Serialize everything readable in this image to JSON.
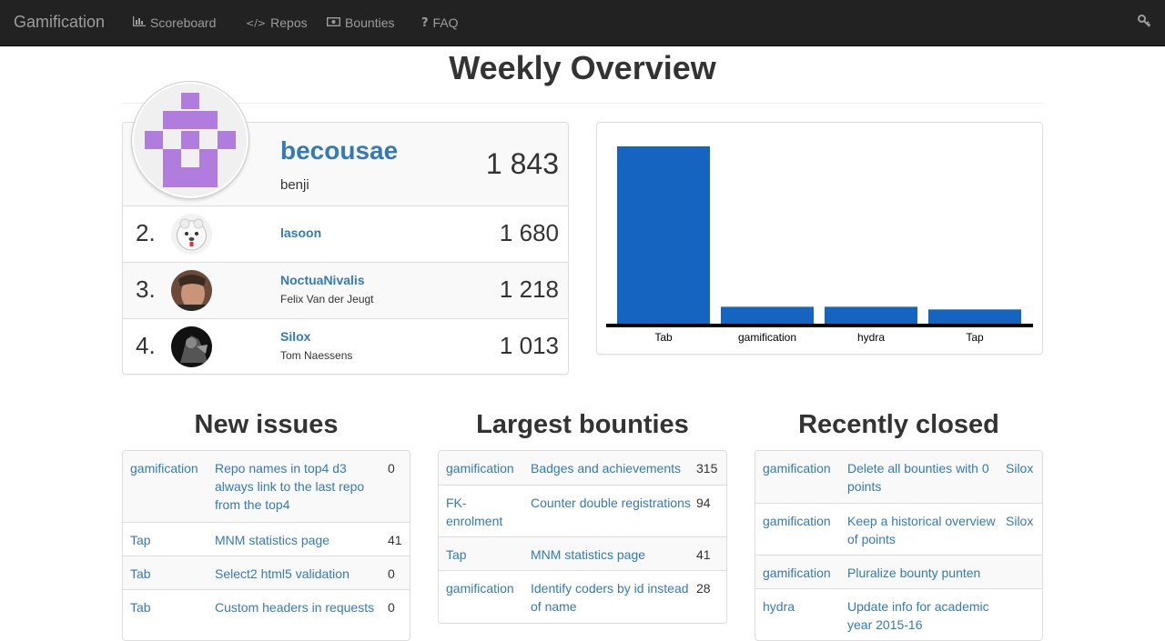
{
  "nav": {
    "brand": "Gamification",
    "items": [
      {
        "label": "Scoreboard",
        "icon": "bar-chart-icon"
      },
      {
        "label": "Repos",
        "icon": "code-icon"
      },
      {
        "label": "Bounties",
        "icon": "money-icon"
      },
      {
        "label": "FAQ",
        "icon": "question-icon"
      }
    ],
    "right_icon": "key-icon"
  },
  "page_title": "Weekly Overview",
  "leaderboard": {
    "top": {
      "name": "becousae",
      "fullname": "benji",
      "score": "1 843"
    },
    "others": [
      {
        "rank": "2.",
        "name": "lasoon",
        "fullname": "",
        "score": "1 680"
      },
      {
        "rank": "3.",
        "name": "NoctuaNivalis",
        "fullname": "Felix Van der Jeugt",
        "score": "1 218"
      },
      {
        "rank": "4.",
        "name": "Silox",
        "fullname": "Tom Naessens",
        "score": "1 013"
      }
    ]
  },
  "chart_data": {
    "type": "bar",
    "categories": [
      "Tab",
      "gamification",
      "hydra",
      "Tap"
    ],
    "values": [
      1000,
      100,
      100,
      85
    ],
    "color": "#1565c0"
  },
  "sections": {
    "new_issues": {
      "title": "New issues",
      "rows": [
        {
          "repo": "gamification",
          "title": "Repo names in top4 d3 always link to the last repo from the top4",
          "value": "0"
        },
        {
          "repo": "Tap",
          "title": "MNM statistics page",
          "value": "41"
        },
        {
          "repo": "Tab",
          "title": "Select2 html5 validation",
          "value": "0"
        },
        {
          "repo": "Tab",
          "title": "Custom headers in requests",
          "value": "0"
        }
      ]
    },
    "largest_bounties": {
      "title": "Largest bounties",
      "rows": [
        {
          "repo": "gamification",
          "title": "Badges and achievements",
          "value": "315"
        },
        {
          "repo": "FK-enrolment",
          "title": "Counter double registrations",
          "value": "94"
        },
        {
          "repo": "Tap",
          "title": "MNM statistics page",
          "value": "41"
        },
        {
          "repo": "gamification",
          "title": "Identify coders by id instead of name",
          "value": "28"
        }
      ]
    },
    "recently_closed": {
      "title": "Recently closed",
      "rows": [
        {
          "repo": "gamification",
          "title": "Delete all bounties with 0 points",
          "value": "Silox"
        },
        {
          "repo": "gamification",
          "title": "Keep a historical overview of points",
          "value": "Silox"
        },
        {
          "repo": "gamification",
          "title": "Pluralize bounty punten",
          "value": ""
        },
        {
          "repo": "hydra",
          "title": "Update info for academic year 2015-16",
          "value": ""
        }
      ]
    }
  },
  "colors": {
    "navbar": "#222222",
    "link": "#337ab7",
    "bar": "#1565c0",
    "identicon": "#b07ddf"
  }
}
